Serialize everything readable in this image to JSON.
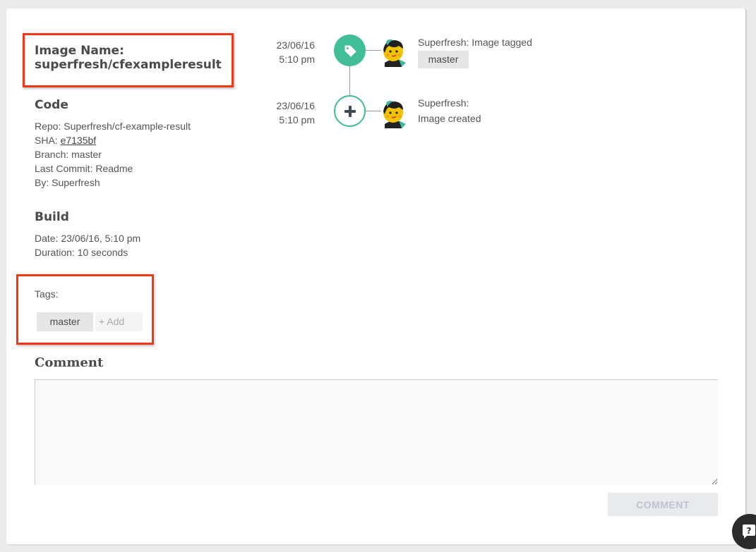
{
  "image": {
    "label": "Image Name:",
    "name": "superfresh/cfexampleresult"
  },
  "code": {
    "title": "Code",
    "repo_label": "Repo:",
    "repo": "Superfresh/cf-example-result",
    "sha_label": "SHA:",
    "sha": "e7135bf",
    "branch_label": "Branch:",
    "branch": "master",
    "last_commit_label": "Last Commit:",
    "last_commit": "Readme",
    "by_label": "By:",
    "by": "Superfresh"
  },
  "build": {
    "title": "Build",
    "date_label": "Date:",
    "date": "23/06/16, 5:10 pm",
    "duration_label": "Duration:",
    "duration": "10 seconds"
  },
  "tags": {
    "label": "Tags:",
    "items": [
      "master"
    ],
    "add_label": "+ Add"
  },
  "comment": {
    "title": "Comment",
    "value": "",
    "placeholder": "",
    "button_label": "COMMENT"
  },
  "timeline": [
    {
      "date": "23/06/16",
      "time": "5:10 pm",
      "icon": "tag-icon",
      "line1": "Superfresh: Image tagged",
      "tag": "master"
    },
    {
      "date": "23/06/16",
      "time": "5:10 pm",
      "icon": "plus-icon",
      "line1": "Superfresh:",
      "line2": "Image created"
    }
  ],
  "colors": {
    "accent": "#41bd98",
    "highlight": "#f03a17"
  },
  "help": {
    "icon": "help-chat-icon",
    "glyph": "?"
  }
}
